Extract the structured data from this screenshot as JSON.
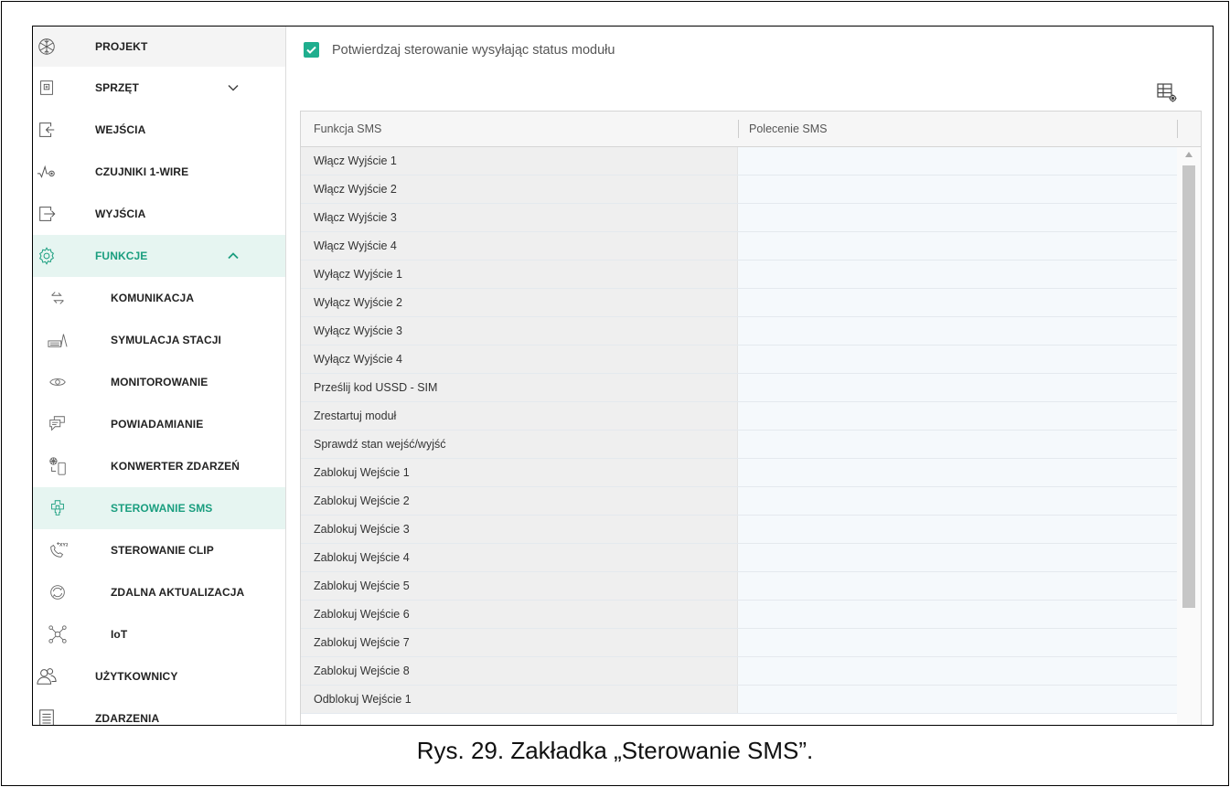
{
  "sidebar": {
    "items": [
      {
        "label": "PROJEKT",
        "icon": "snowflake-icon"
      },
      {
        "label": "SPRZĘT",
        "icon": "chip-icon",
        "chevron": "down"
      },
      {
        "label": "WEJŚCIA",
        "icon": "input-arrow-icon"
      },
      {
        "label": "CZUJNIKI 1-WIRE",
        "icon": "sensor-wave-icon"
      },
      {
        "label": "WYJŚCIA",
        "icon": "output-arrow-icon"
      },
      {
        "label": "FUNKCJE",
        "icon": "gear-icon",
        "chevron": "up",
        "expanded": true
      }
    ],
    "subitems": [
      {
        "label": "KOMUNIKACJA",
        "icon": "exchange-arrows-icon"
      },
      {
        "label": "SYMULACJA STACJI",
        "icon": "keyboard-station-icon"
      },
      {
        "label": "MONITOROWANIE",
        "icon": "eye-icon"
      },
      {
        "label": "POWIADAMIANIE",
        "icon": "chat-bubbles-icon"
      },
      {
        "label": "KONWERTER ZDARZEŃ",
        "icon": "converter-icon"
      },
      {
        "label": "STEROWANIE SMS",
        "icon": "sms-control-icon",
        "active": true
      },
      {
        "label": "STEROWANIE CLIP",
        "icon": "phone-clip-icon"
      },
      {
        "label": "ZDALNA AKTUALIZACJA",
        "icon": "refresh-icon"
      },
      {
        "label": "IoT",
        "icon": "network-nodes-icon"
      }
    ],
    "bottom_items": [
      {
        "label": "UŻYTKOWNICY",
        "icon": "users-icon"
      },
      {
        "label": "ZDARZENIA",
        "icon": "document-list-icon"
      }
    ]
  },
  "main": {
    "confirm_checkbox": {
      "label": "Potwierdzaj sterowanie wysyłając status modułu",
      "checked": true
    },
    "columns_button_icon": "table-settings-icon",
    "table": {
      "headers": [
        "Funkcja SMS",
        "Polecenie SMS"
      ],
      "rows": [
        {
          "func": "Włącz Wyjście 1",
          "cmd": ""
        },
        {
          "func": "Włącz Wyjście 2",
          "cmd": ""
        },
        {
          "func": "Włącz Wyjście 3",
          "cmd": ""
        },
        {
          "func": "Włącz Wyjście 4",
          "cmd": ""
        },
        {
          "func": "Wyłącz Wyjście 1",
          "cmd": ""
        },
        {
          "func": "Wyłącz Wyjście 2",
          "cmd": ""
        },
        {
          "func": "Wyłącz Wyjście 3",
          "cmd": ""
        },
        {
          "func": "Wyłącz Wyjście 4",
          "cmd": ""
        },
        {
          "func": "Prześlij kod USSD - SIM",
          "cmd": ""
        },
        {
          "func": "Zrestartuj moduł",
          "cmd": ""
        },
        {
          "func": "Sprawdź stan wejść/wyjść",
          "cmd": ""
        },
        {
          "func": "Zablokuj Wejście 1",
          "cmd": ""
        },
        {
          "func": "Zablokuj Wejście 2",
          "cmd": ""
        },
        {
          "func": "Zablokuj Wejście 3",
          "cmd": ""
        },
        {
          "func": "Zablokuj Wejście 4",
          "cmd": ""
        },
        {
          "func": "Zablokuj Wejście 5",
          "cmd": ""
        },
        {
          "func": "Zablokuj Wejście 6",
          "cmd": ""
        },
        {
          "func": "Zablokuj Wejście 7",
          "cmd": ""
        },
        {
          "func": "Zablokuj Wejście 8",
          "cmd": ""
        },
        {
          "func": "Odblokuj Wejście 1",
          "cmd": ""
        }
      ]
    }
  },
  "caption": "Rys. 29. Zakładka „Sterowanie SMS”.",
  "colors": {
    "accent": "#1a9e7f",
    "checkbox": "#1fae8e",
    "active_bg": "#e6f5f1"
  }
}
